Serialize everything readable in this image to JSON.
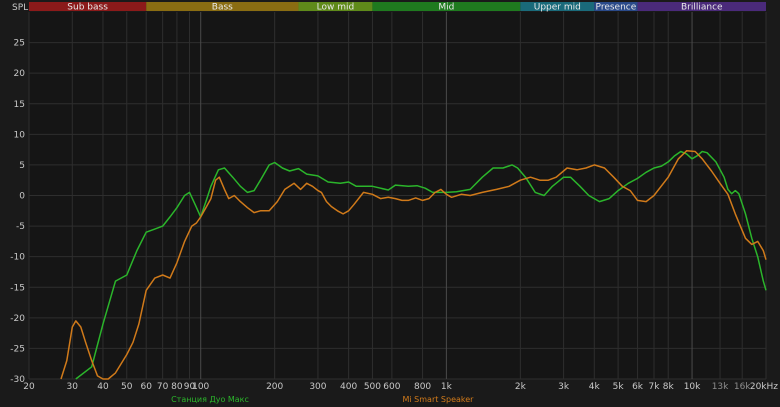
{
  "chart_data": {
    "type": "line",
    "ylabel": "SPL",
    "x_scale": "log",
    "xlim": [
      20,
      20000
    ],
    "ylim": [
      -30,
      30
    ],
    "grid": true,
    "legend_position": "bottom",
    "bands": [
      {
        "label": "Sub bass",
        "from": 20,
        "to": 60,
        "color": "#8b1a1a"
      },
      {
        "label": "Bass",
        "from": 60,
        "to": 250,
        "color": "#8a6d12"
      },
      {
        "label": "Low mid",
        "from": 250,
        "to": 500,
        "color": "#5f8a1a"
      },
      {
        "label": "Mid",
        "from": 500,
        "to": 2000,
        "color": "#1f7a1f"
      },
      {
        "label": "Upper mid",
        "from": 2000,
        "to": 4000,
        "color": "#1a6a7a"
      },
      {
        "label": "Presence",
        "from": 4000,
        "to": 6000,
        "color": "#2a4a8a"
      },
      {
        "label": "Brilliance",
        "from": 6000,
        "to": 20000,
        "color": "#4a2a7a"
      }
    ],
    "y_ticks": [
      25,
      20,
      15,
      10,
      5,
      0,
      -5,
      -10,
      -15,
      -20,
      -25,
      -30
    ],
    "x_ticks": [
      {
        "value": 20,
        "label": "20"
      },
      {
        "value": 30,
        "label": "30"
      },
      {
        "value": 40,
        "label": "40"
      },
      {
        "value": 50,
        "label": "50"
      },
      {
        "value": 60,
        "label": "60"
      },
      {
        "value": 70,
        "label": "70"
      },
      {
        "value": 80,
        "label": "80"
      },
      {
        "value": 90,
        "label": "90"
      },
      {
        "value": 100,
        "label": "100"
      },
      {
        "value": 200,
        "label": "200"
      },
      {
        "value": 300,
        "label": "300"
      },
      {
        "value": 400,
        "label": "400"
      },
      {
        "value": 500,
        "label": "500"
      },
      {
        "value": 600,
        "label": "600"
      },
      {
        "value": 800,
        "label": "800"
      },
      {
        "value": 1000,
        "label": "1k"
      },
      {
        "value": 2000,
        "label": "2k"
      },
      {
        "value": 3000,
        "label": "3k"
      },
      {
        "value": 4000,
        "label": "4k"
      },
      {
        "value": 5000,
        "label": "5k"
      },
      {
        "value": 6000,
        "label": "6k"
      },
      {
        "value": 7000,
        "label": "7k"
      },
      {
        "value": 8000,
        "label": "8k"
      },
      {
        "value": 10000,
        "label": "10k"
      },
      {
        "value": 13000,
        "label": "13k"
      },
      {
        "value": 16000,
        "label": "16k"
      },
      {
        "value": 20000,
        "label": "20kHz"
      }
    ],
    "series": [
      {
        "name": "Станция Дуо Макс",
        "color": "#2bb52b",
        "points": [
          [
            31,
            -36
          ],
          [
            36,
            -28
          ],
          [
            40,
            -21
          ],
          [
            45,
            -14
          ],
          [
            50,
            -13
          ],
          [
            55,
            -9
          ],
          [
            60,
            -6
          ],
          [
            65,
            -5.5
          ],
          [
            70,
            -5
          ],
          [
            75,
            -3.5
          ],
          [
            80,
            -2
          ],
          [
            86,
            0
          ],
          [
            90,
            0.5
          ],
          [
            95,
            -1.5
          ],
          [
            100,
            -3.5
          ],
          [
            105,
            -1
          ],
          [
            110,
            1.5
          ],
          [
            118,
            4.2
          ],
          [
            125,
            4.5
          ],
          [
            135,
            3
          ],
          [
            145,
            1.5
          ],
          [
            155,
            0.5
          ],
          [
            165,
            0.8
          ],
          [
            175,
            2.5
          ],
          [
            190,
            5
          ],
          [
            200,
            5.4
          ],
          [
            215,
            4.5
          ],
          [
            230,
            4
          ],
          [
            250,
            4.4
          ],
          [
            270,
            3.5
          ],
          [
            300,
            3.2
          ],
          [
            330,
            2.2
          ],
          [
            370,
            2
          ],
          [
            400,
            2.2
          ],
          [
            430,
            1.5
          ],
          [
            460,
            1.5
          ],
          [
            500,
            1.5
          ],
          [
            540,
            1.2
          ],
          [
            580,
            0.9
          ],
          [
            620,
            1.7
          ],
          [
            700,
            1.5
          ],
          [
            760,
            1.6
          ],
          [
            820,
            1.2
          ],
          [
            880,
            0.5
          ],
          [
            950,
            0.5
          ],
          [
            1000,
            0.5
          ],
          [
            1100,
            0.6
          ],
          [
            1250,
            1
          ],
          [
            1400,
            3
          ],
          [
            1550,
            4.5
          ],
          [
            1700,
            4.5
          ],
          [
            1850,
            5
          ],
          [
            1950,
            4.5
          ],
          [
            2100,
            3
          ],
          [
            2300,
            0.5
          ],
          [
            2500,
            0
          ],
          [
            2700,
            1.5
          ],
          [
            3000,
            3
          ],
          [
            3200,
            3
          ],
          [
            3500,
            1.5
          ],
          [
            3800,
            0
          ],
          [
            4200,
            -1
          ],
          [
            4600,
            -0.5
          ],
          [
            5000,
            0.8
          ],
          [
            5500,
            2
          ],
          [
            6000,
            2.8
          ],
          [
            6500,
            3.8
          ],
          [
            7000,
            4.5
          ],
          [
            7500,
            4.8
          ],
          [
            8000,
            5.5
          ],
          [
            8500,
            6.5
          ],
          [
            9000,
            7.2
          ],
          [
            9500,
            6.8
          ],
          [
            10000,
            6
          ],
          [
            10500,
            6.5
          ],
          [
            11000,
            7.2
          ],
          [
            11500,
            7
          ],
          [
            12500,
            5.5
          ],
          [
            13500,
            3
          ],
          [
            14000,
            1
          ],
          [
            14500,
            0.3
          ],
          [
            15000,
            0.8
          ],
          [
            15500,
            0.3
          ],
          [
            16500,
            -3
          ],
          [
            17500,
            -7
          ],
          [
            18500,
            -10
          ],
          [
            19500,
            -14
          ],
          [
            20000,
            -15.5
          ]
        ]
      },
      {
        "name": "Mi Smart Speaker",
        "color": "#d07a1a",
        "points": [
          [
            27,
            -32
          ],
          [
            28.5,
            -27
          ],
          [
            30,
            -21.5
          ],
          [
            31,
            -20.5
          ],
          [
            32.5,
            -21.5
          ],
          [
            34,
            -24
          ],
          [
            36,
            -27
          ],
          [
            38,
            -29.5
          ],
          [
            40,
            -30.5
          ],
          [
            42,
            -30.5
          ],
          [
            45,
            -29
          ],
          [
            50,
            -26
          ],
          [
            53,
            -24
          ],
          [
            56,
            -21
          ],
          [
            60,
            -15.5
          ],
          [
            65,
            -13.5
          ],
          [
            70,
            -13
          ],
          [
            75,
            -13.5
          ],
          [
            80,
            -11
          ],
          [
            86,
            -7.5
          ],
          [
            92,
            -5
          ],
          [
            96,
            -4.5
          ],
          [
            100,
            -3.5
          ],
          [
            105,
            -2
          ],
          [
            110,
            -0.5
          ],
          [
            115,
            2.5
          ],
          [
            119,
            3
          ],
          [
            125,
            1
          ],
          [
            130,
            -0.5
          ],
          [
            137,
            0
          ],
          [
            145,
            -1
          ],
          [
            155,
            -2
          ],
          [
            165,
            -2.8
          ],
          [
            175,
            -2.5
          ],
          [
            190,
            -2.5
          ],
          [
            205,
            -1
          ],
          [
            220,
            1
          ],
          [
            240,
            2
          ],
          [
            255,
            1
          ],
          [
            270,
            2
          ],
          [
            285,
            1.5
          ],
          [
            300,
            0.8
          ],
          [
            310,
            0.5
          ],
          [
            325,
            -1
          ],
          [
            340,
            -1.8
          ],
          [
            360,
            -2.5
          ],
          [
            380,
            -3
          ],
          [
            400,
            -2.5
          ],
          [
            420,
            -1.5
          ],
          [
            460,
            0.5
          ],
          [
            500,
            0.2
          ],
          [
            540,
            -0.5
          ],
          [
            580,
            -0.3
          ],
          [
            620,
            -0.5
          ],
          [
            660,
            -0.8
          ],
          [
            700,
            -0.8
          ],
          [
            750,
            -0.4
          ],
          [
            800,
            -0.8
          ],
          [
            850,
            -0.5
          ],
          [
            900,
            0.5
          ],
          [
            950,
            1
          ],
          [
            1000,
            0.2
          ],
          [
            1050,
            -0.3
          ],
          [
            1150,
            0.2
          ],
          [
            1250,
            0
          ],
          [
            1400,
            0.5
          ],
          [
            1600,
            1
          ],
          [
            1800,
            1.5
          ],
          [
            2000,
            2.5
          ],
          [
            2200,
            3
          ],
          [
            2400,
            2.5
          ],
          [
            2600,
            2.5
          ],
          [
            2800,
            3
          ],
          [
            3100,
            4.5
          ],
          [
            3400,
            4.2
          ],
          [
            3700,
            4.5
          ],
          [
            4000,
            5
          ],
          [
            4400,
            4.5
          ],
          [
            4800,
            3
          ],
          [
            5200,
            1.5
          ],
          [
            5600,
            0.8
          ],
          [
            6000,
            -0.8
          ],
          [
            6500,
            -1
          ],
          [
            7000,
            0
          ],
          [
            8000,
            3
          ],
          [
            8800,
            6
          ],
          [
            9500,
            7.3
          ],
          [
            10300,
            7.2
          ],
          [
            11000,
            6
          ],
          [
            12000,
            4
          ],
          [
            13000,
            2
          ],
          [
            14000,
            0.2
          ],
          [
            15000,
            -3
          ],
          [
            16500,
            -7
          ],
          [
            17500,
            -8
          ],
          [
            18500,
            -7.5
          ],
          [
            19500,
            -9
          ],
          [
            20000,
            -10.5
          ]
        ]
      }
    ]
  }
}
